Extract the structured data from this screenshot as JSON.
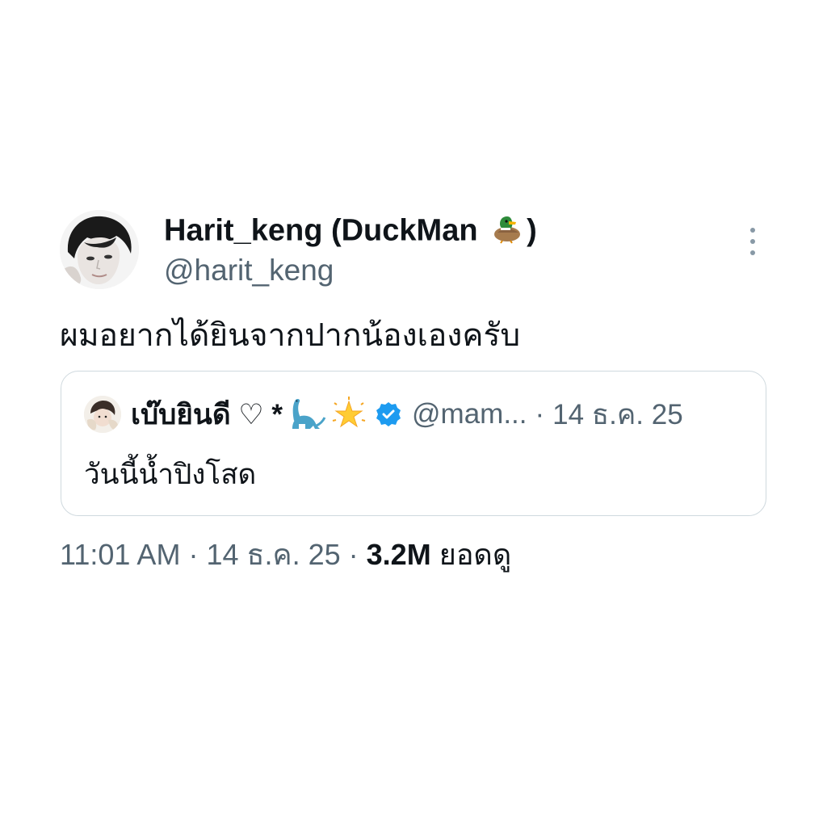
{
  "tweet": {
    "author": {
      "display_name": "Harit_keng (DuckMan",
      "display_name_close": ")",
      "name_emoji": "duck-icon",
      "handle": "@harit_keng"
    },
    "text": "ผมอยากได้ยินจากปากน้องเองครับ",
    "quoted": {
      "display_name": "เบ๊บยินดี ♡ *",
      "name_emojis": [
        "sauropod-icon",
        "glowing-star-icon"
      ],
      "verified": true,
      "handle": "@mam...",
      "separator": "·",
      "date": "14 ธ.ค. 25",
      "text": "วันนี้น้ำปิงโสด"
    },
    "meta": {
      "time": "11:01 AM",
      "separator": "·",
      "date": "14 ธ.ค. 25",
      "separator2": "·",
      "views_count": "3.2M",
      "views_label": "ยอดดู"
    }
  },
  "colors": {
    "text": "#0f1419",
    "secondary": "#536471",
    "border": "#cfd9de",
    "verified": "#1d9bf0"
  }
}
